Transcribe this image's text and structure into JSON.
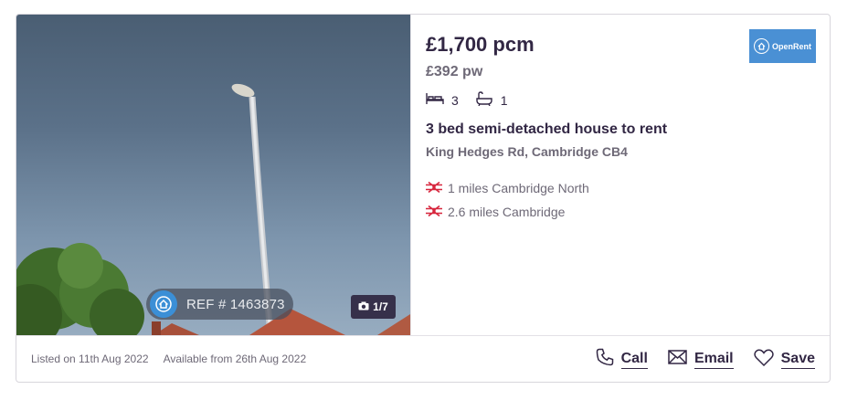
{
  "listing": {
    "image": {
      "ref_label": "REF # 1463873",
      "photo_count": "1/7"
    },
    "price_pcm": "£1,700 pcm",
    "price_pw": "£392 pw",
    "bedrooms": "3",
    "bathrooms": "1",
    "title": "3 bed semi-detached house to rent",
    "address": "King Hedges Rd, Cambridge CB4",
    "stations": [
      {
        "text": "1 miles Cambridge North"
      },
      {
        "text": "2.6 miles Cambridge"
      }
    ],
    "agent": {
      "name": "OpenRent",
      "color": "#4a90d4"
    },
    "footer": {
      "listed": "Listed on 11th Aug 2022",
      "available": "Available from 26th Aug 2022"
    },
    "actions": {
      "call": "Call",
      "email": "Email",
      "save": "Save"
    },
    "colors": {
      "text_primary": "#322744",
      "text_secondary": "#6e6977",
      "rail_icon": "#d7263d"
    },
    "icons": [
      "bed-icon",
      "bath-icon",
      "rail-icon",
      "camera-icon",
      "phone-icon",
      "mail-icon",
      "heart-icon",
      "house-icon"
    ]
  }
}
